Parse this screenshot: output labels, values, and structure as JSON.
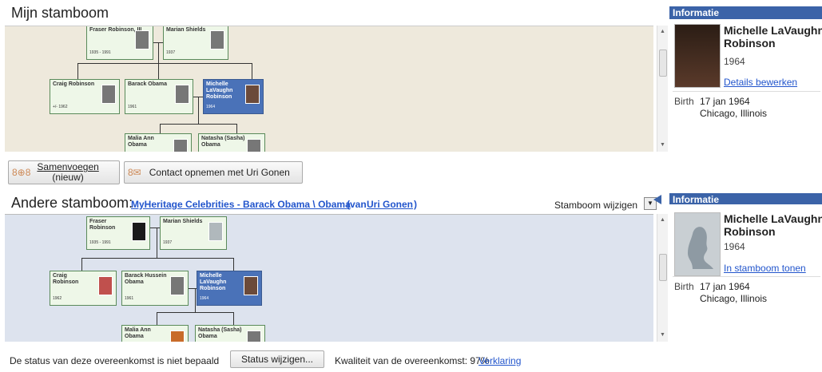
{
  "top": {
    "title": "Mijn stamboom",
    "tree": [
      {
        "name": "Fraser Robinson, III",
        "dates": "1935 - 1991"
      },
      {
        "name": "Marian Shields",
        "dates": "1937"
      },
      {
        "name": "Craig Robinson",
        "dates": "+/- 1962"
      },
      {
        "name": "Barack Obama",
        "dates": "1961"
      },
      {
        "name": "Michelle LaVaughn Robinson",
        "dates": "1964"
      },
      {
        "name": "Malia Ann Obama",
        "dates": ""
      },
      {
        "name": "Natasha (Sasha) Obama",
        "dates": ""
      }
    ],
    "info": {
      "header": "Informatie",
      "name": "Michelle LaVaughn Robinson",
      "year": "1964",
      "link": "Details bewerken",
      "birth_label": "Birth",
      "birth_date": "17 jan 1964",
      "birth_place": "Chicago, Illinois"
    }
  },
  "buttons": {
    "merge_line1": "Samenvoegen",
    "merge_line2": "(nieuw)",
    "contact": "Contact opnemen met Uri Gonen"
  },
  "bottom": {
    "title": "Andere stamboom:",
    "tree_link": "MyHeritage Celebrities - Barack Obama \\ Obama",
    "van_open": "(van",
    "user": "Uri Gonen",
    "van_close": ")",
    "change_label": "Stamboom wijzigen",
    "tree": [
      {
        "name": "Fraser Robinson",
        "dates": "1935 - 1991"
      },
      {
        "name": "Marian Shields",
        "dates": "1937"
      },
      {
        "name": "Craig Robinson",
        "dates": "1962"
      },
      {
        "name": "Barack Hussein Obama",
        "dates": "1961"
      },
      {
        "name": "Michelle LaVaughn Robinson",
        "dates": "1964"
      },
      {
        "name": "Malia Ann Obama",
        "dates": ""
      },
      {
        "name": "Natasha (Sasha) Obama",
        "dates": ""
      }
    ],
    "info": {
      "header": "Informatie",
      "name": "Michelle LaVaughn Robinson",
      "year": "1964",
      "link": "In stamboom tonen",
      "birth_label": "Birth",
      "birth_date": "17 jan 1964",
      "birth_place": "Chicago, Illinois"
    }
  },
  "status": {
    "text": "De status van deze overeenkomst is niet bepaald",
    "button": "Status wijzigen...",
    "quality": "Kwaliteit van de overeenkomst: 97%",
    "link": "Verklaring"
  }
}
